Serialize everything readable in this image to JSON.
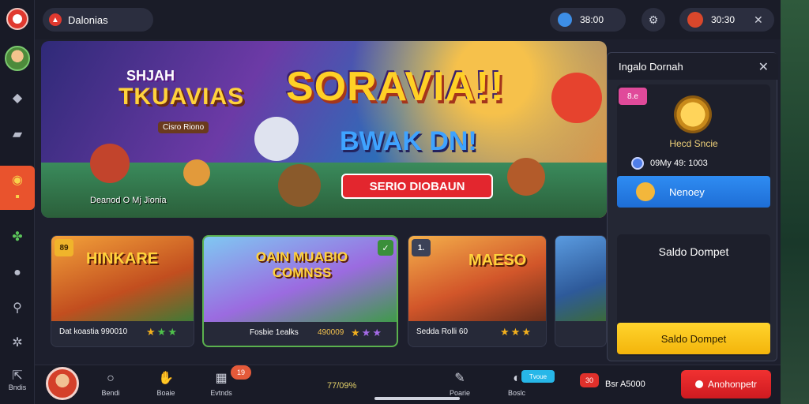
{
  "topbar": {
    "brand": "Dalonias",
    "coins": "38:00",
    "user_value": "30:30"
  },
  "rail": {
    "bottom_label": "Bndis"
  },
  "hero": {
    "logo_line1": "SHJAH",
    "logo_line2": "TKUAVIAS",
    "logo_tag": "Cisro Riono",
    "headline": "SORAVIA!!",
    "subline": "BWAK DN!",
    "cta": "SERIO DIOBAUN",
    "caption": "Deanod O Mj Jionia"
  },
  "cards": [
    {
      "badge": "89",
      "title": "HINKARE",
      "info": "Dat koastia 990010",
      "stars": "★★★",
      "star_colors": [
        "#f2b01e",
        "#4fc14b",
        "#4fc14b"
      ]
    },
    {
      "badge": "",
      "title": "OAIN MUABIO COMNSS",
      "info": "Fosbie 1ealks",
      "extra": "490009",
      "stars": "★★★",
      "active": true,
      "star_colors": [
        "#f2b01e",
        "#a56be8",
        "#a56be8"
      ]
    },
    {
      "badge": "1.",
      "title": "MAESO",
      "info": "Sedda Rolli 60",
      "stars": "★★★",
      "star_colors": [
        "#f2b01e",
        "#f2b01e",
        "#f2b01e"
      ]
    },
    {
      "badge": "",
      "title": "",
      "info": "",
      "stars": ""
    }
  ],
  "panel": {
    "title": "Ingalo Dornah",
    "reward_tag": "8.e",
    "reward_name": "Hecd Sncie",
    "reward_info": "09My 49: 1003",
    "blue_btn": "Nenoey",
    "wallet_title": "Saldo Dompet",
    "yellow_btn": "Saldo Dompet"
  },
  "bottom": {
    "nav": [
      {
        "label": "Bendi"
      },
      {
        "label": "Boaie"
      },
      {
        "label": "Evtnds"
      }
    ],
    "nav_badge": "19",
    "stat": "77/09%",
    "nav_right": [
      {
        "label": "Poarie"
      },
      {
        "label": "Boslc"
      }
    ],
    "chip": "Tvoue",
    "red_coin": "30",
    "coin_text": "Bsr A5000",
    "red_btn": "Anohonpetr"
  },
  "colors": {
    "accent_red": "#e3262e",
    "accent_yellow": "#ffd026",
    "accent_blue": "#2f8cf2",
    "rail_active": "#e9532d"
  }
}
